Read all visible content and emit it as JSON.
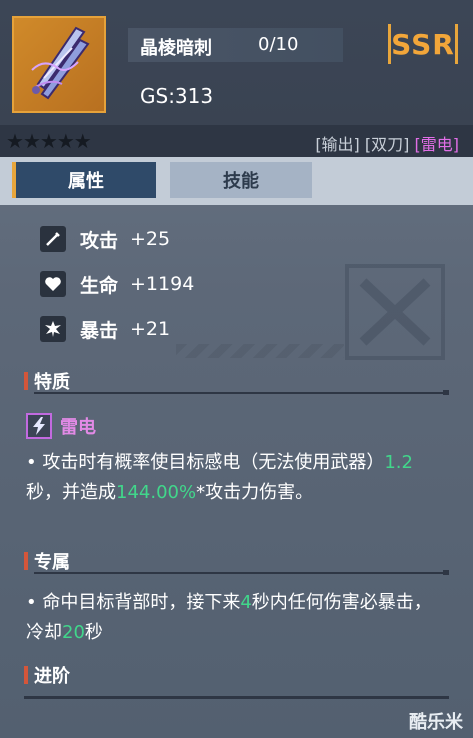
{
  "weapon": {
    "name": "晶棱暗刺",
    "level": "0/10",
    "gs": "GS:313",
    "rarity": "SSR"
  },
  "star_count": 5,
  "tags": {
    "role": "[输出]",
    "weapon_type": "[双刀]",
    "element": "[雷电]"
  },
  "tabs": {
    "attributes": "属性",
    "skills": "技能"
  },
  "stats": [
    {
      "icon": "sword-icon",
      "label": "攻击",
      "value": "+25"
    },
    {
      "icon": "heart-icon",
      "label": "生命",
      "value": "+1194"
    },
    {
      "icon": "burst-icon",
      "label": "暴击",
      "value": "+21"
    }
  ],
  "sections": {
    "traits": "特质",
    "exclusive": "专属",
    "advance": "进阶"
  },
  "trait": {
    "name": "雷电",
    "desc_1": "• 攻击时有概率使目标感电（无法使用武器）",
    "desc_num_1": "1.2",
    "desc_2": "秒，并造成",
    "desc_num_2": "144.00%",
    "desc_3": "*攻击力伤害。"
  },
  "exclusive": {
    "desc_1": "• 命中目标背部时，接下来",
    "desc_num_1": "4",
    "desc_2": "秒内任何伤害必暴击，冷却",
    "desc_num_2": "20",
    "desc_3": "秒"
  },
  "brand": "酷乐米",
  "colors": {
    "rarity": "#f2a63a",
    "element": "#e06ee6",
    "number_highlight": "#41d78b",
    "section_accent": "#d4563a"
  }
}
